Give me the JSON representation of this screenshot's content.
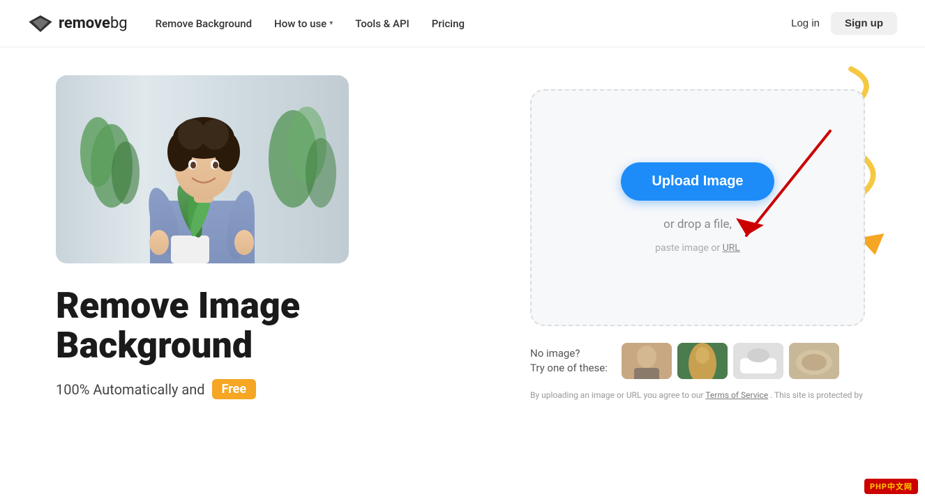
{
  "nav": {
    "logo_text": "remove",
    "logo_text2": "bg",
    "link_remove_bg": "Remove Background",
    "link_how_to_use": "How to use",
    "link_tools_api": "Tools & API",
    "link_pricing": "Pricing",
    "btn_login": "Log in",
    "btn_signup": "Sign up"
  },
  "hero": {
    "title_line1": "Remove Image",
    "title_line2": "Background",
    "subtitle": "100% Automatically and",
    "free_badge": "Free"
  },
  "upload": {
    "btn_label": "Upload Image",
    "drop_text": "or drop a file,",
    "paste_text": "paste image or",
    "paste_link": "URL"
  },
  "samples": {
    "no_image": "No image?",
    "try_one": "Try one of these:"
  },
  "footer": {
    "text": "By uploading an image or URL you agree to our",
    "tos_link": "Terms of Service",
    "text2": ". This site is protected by"
  },
  "php_badge": {
    "text": "PHP",
    "suffix": "中文网"
  }
}
